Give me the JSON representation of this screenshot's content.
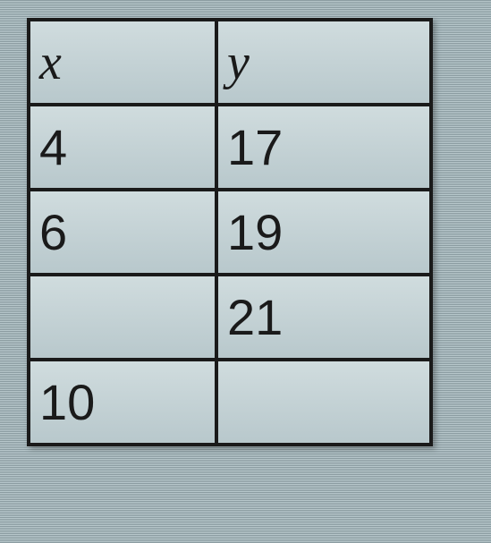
{
  "chart_data": {
    "type": "table",
    "columns": [
      "x",
      "y"
    ],
    "rows": [
      {
        "x": "4",
        "y": "17"
      },
      {
        "x": "6",
        "y": "19"
      },
      {
        "x": "",
        "y": "21"
      },
      {
        "x": "10",
        "y": ""
      }
    ]
  },
  "headers": {
    "col1": "x",
    "col2": "y"
  },
  "rows": [
    {
      "x": "4",
      "y": "17"
    },
    {
      "x": "6",
      "y": "19"
    },
    {
      "x": "",
      "y": "21"
    },
    {
      "x": "10",
      "y": ""
    }
  ]
}
